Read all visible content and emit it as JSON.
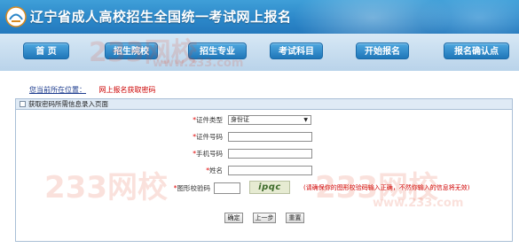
{
  "header": {
    "title": "辽宁省成人高校招生全国统一考试网上报名"
  },
  "nav": {
    "items": [
      "首 页",
      "招生院校",
      "招生专业",
      "考试科目",
      "开始报名",
      "报名确认点"
    ]
  },
  "watermark": {
    "big": "233网校",
    "small": "www.233.com"
  },
  "breadcrumb": {
    "label": "您当前所在位置：",
    "current": "网上报名获取密码"
  },
  "form": {
    "title": "获取密码所需信息录入页面",
    "fields": {
      "id_type_label": "证件类型",
      "id_type_value": "身份证",
      "id_number_label": "证件号码",
      "phone_label": "手机号码",
      "name_label": "姓名",
      "captcha_label": "图形校验码"
    },
    "captcha_text": "ipqc",
    "captcha_hint": "(请确保你的图形校验码输入正确，不然你输入的信息将无效)",
    "required_mark": "*",
    "buttons": {
      "confirm": "确定",
      "prev": "上一步",
      "reset": "重置"
    }
  },
  "colors": {
    "header_bg": "#2b86c8",
    "nav_bg": "#c6dcee",
    "nav_button": "#2a82c4",
    "required": "#e00000",
    "breadcrumb_current": "#cc0000"
  }
}
